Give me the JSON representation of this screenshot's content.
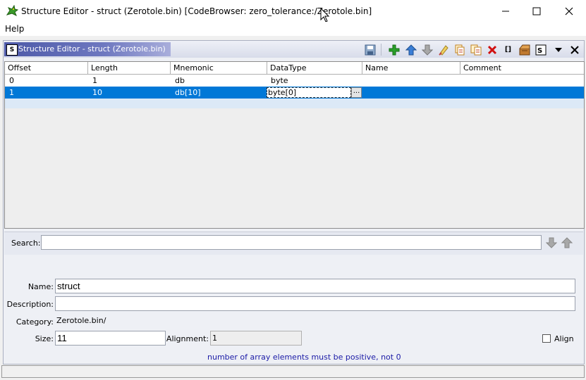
{
  "window": {
    "title": "Structure Editor - struct (Zerotole.bin) [CodeBrowser: zero_tolerance:/Zerotole.bin]",
    "controls": [
      "minimize-icon",
      "maximize-icon",
      "close-icon"
    ]
  },
  "menu": {
    "help": "Help"
  },
  "panel": {
    "title": "Structure Editor - struct (Zerotole.bin)",
    "toolbar_icons": [
      "save-icon",
      "add-icon",
      "move-up-icon",
      "move-down-icon",
      "clear-icon",
      "duplicate-icon",
      "duplicate-multiple-icon",
      "delete-icon",
      "create-array-icon",
      "unpackage-icon",
      "show-component-path-icon",
      "menu-dropdown-icon",
      "close-icon"
    ],
    "array_icon_text": "[]",
    "se_icon_text": "S"
  },
  "table": {
    "columns": [
      "Offset",
      "Length",
      "Mnemonic",
      "DataType",
      "Name",
      "Comment"
    ],
    "rows": [
      {
        "offset": "0",
        "length": "1",
        "mnemonic": "db",
        "datatype": "byte",
        "name": "",
        "comment": ""
      },
      {
        "offset": "1",
        "length": "10",
        "mnemonic": "db[10]",
        "datatype": "byte[0]",
        "name": "",
        "comment": ""
      }
    ],
    "edit_button": "..."
  },
  "search": {
    "label": "Search:",
    "value": ""
  },
  "form": {
    "name_label": "Name:",
    "name_value": "struct",
    "description_label": "Description:",
    "description_value": "",
    "category_label": "Category:",
    "category_value": "Zerotole.bin/",
    "size_label": "Size:",
    "size_value": "11",
    "alignment_label": "Alignment:",
    "alignment_value": "1",
    "align_label": "Align",
    "align_checked": false
  },
  "status": {
    "message": "number of array elements must be positive, not 0"
  },
  "colors": {
    "selection": "#0078d7",
    "panel_title": "#4d59a8",
    "error_text": "#1a1aa6"
  }
}
